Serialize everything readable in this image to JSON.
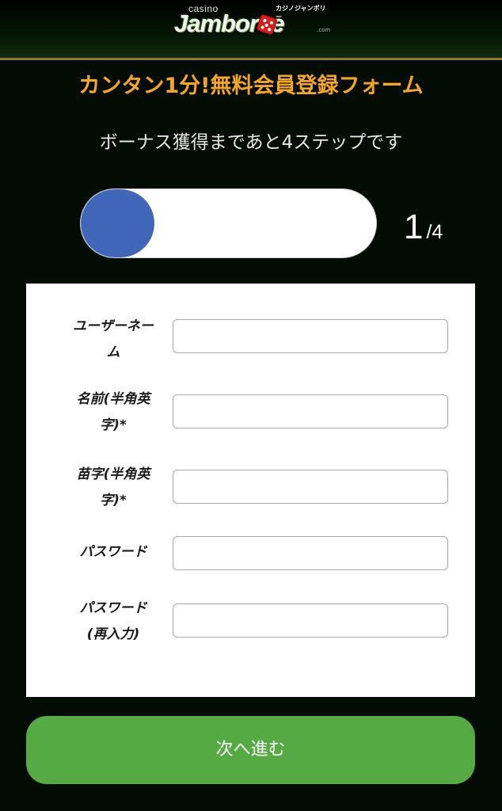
{
  "header": {
    "logo_casino": "casino",
    "logo_main": "Jamboree",
    "logo_kana": "カジノジャンボリー",
    "logo_com": ".com"
  },
  "title": "カンタン1分!無料会員登録フォーム",
  "subtitle": "ボーナス獲得まであと4ステップです",
  "progress": {
    "current": "1",
    "total": "/4",
    "fraction": 0.25,
    "fill_color": "#3f66b8"
  },
  "form": {
    "fields": [
      {
        "label_line1": "ユーザーネー",
        "label_line2": "ム",
        "value": "",
        "type": "text"
      },
      {
        "label_line1": "名前(半角英",
        "label_line2": "字)*",
        "value": "",
        "type": "text"
      },
      {
        "label_line1": "苗字(半角英",
        "label_line2": "字)*",
        "value": "",
        "type": "text"
      },
      {
        "label_line1": "パスワード",
        "label_line2": "",
        "value": "",
        "type": "password"
      },
      {
        "label_line1": "パスワード",
        "label_line2": "(再入力)",
        "value": "",
        "type": "password"
      }
    ]
  },
  "next_button": {
    "label": "次へ進む",
    "color": "#56aa44"
  },
  "colors": {
    "background": "#020c02",
    "title": "#f5a623",
    "header_border": "#8e7a33"
  }
}
